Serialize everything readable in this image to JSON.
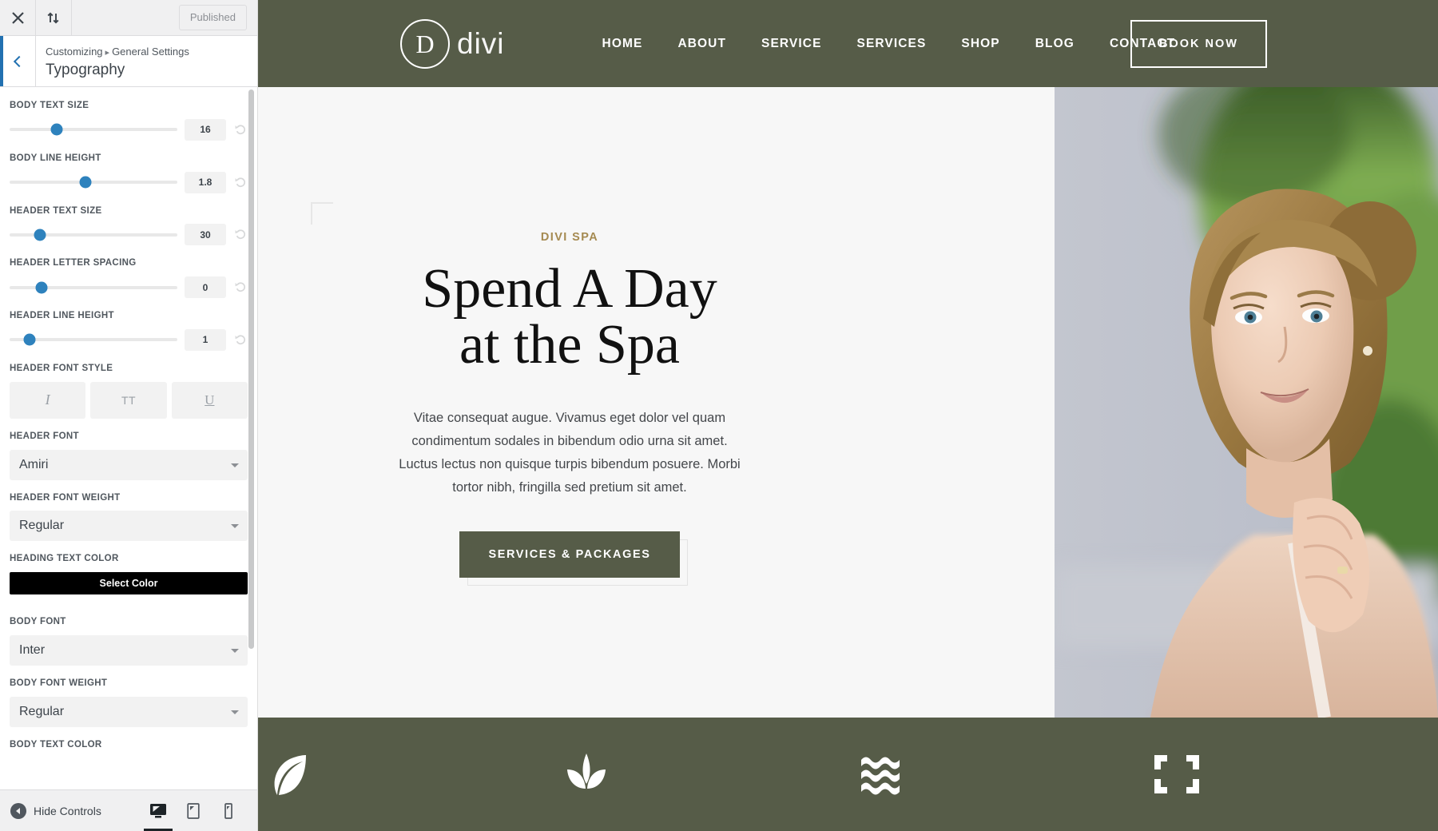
{
  "customizer": {
    "topbar": {
      "close_icon": "close-icon",
      "devices_icon": "collapse-arrows-icon",
      "published_label": "Published"
    },
    "header": {
      "back_icon": "chevron-left-icon",
      "breadcrumb_root": "Customizing",
      "breadcrumb_separator": "▸",
      "breadcrumb_parent": "General Settings",
      "title": "Typography"
    },
    "fields": [
      {
        "label": "BODY TEXT SIZE",
        "type": "range",
        "value": "16",
        "thumb_pct": 28
      },
      {
        "label": "BODY LINE HEIGHT",
        "type": "range",
        "value": "1.8",
        "thumb_pct": 45
      },
      {
        "label": "HEADER TEXT SIZE",
        "type": "range",
        "value": "30",
        "thumb_pct": 18
      },
      {
        "label": "HEADER LETTER SPACING",
        "type": "range",
        "value": "0",
        "thumb_pct": 19
      },
      {
        "label": "HEADER LINE HEIGHT",
        "type": "range",
        "value": "1",
        "thumb_pct": 12
      },
      {
        "label": "HEADER FONT STYLE",
        "type": "styles",
        "options": [
          "I",
          "TT",
          "U"
        ]
      },
      {
        "label": "HEADER FONT",
        "type": "select",
        "value": "Amiri"
      },
      {
        "label": "HEADER FONT WEIGHT",
        "type": "select",
        "value": "Regular"
      },
      {
        "label": "HEADING TEXT COLOR",
        "type": "color",
        "value": "Select Color",
        "swatch": "#000000"
      },
      {
        "label": "BODY FONT",
        "type": "select",
        "value": "Inter"
      },
      {
        "label": "BODY FONT WEIGHT",
        "type": "select",
        "value": "Regular"
      },
      {
        "label": "BODY TEXT COLOR",
        "type": "labelonly"
      }
    ],
    "footer": {
      "hide_controls_label": "Hide Controls",
      "devices": [
        {
          "name": "desktop-preview-button",
          "active": true
        },
        {
          "name": "tablet-preview-button",
          "active": false
        },
        {
          "name": "mobile-preview-button",
          "active": false
        }
      ]
    }
  },
  "preview": {
    "brand": {
      "mark_letter": "D",
      "word": "divi"
    },
    "nav_items": [
      "HOME",
      "ABOUT",
      "SERVICE",
      "SERVICES",
      "SHOP",
      "BLOG",
      "CONTACT"
    ],
    "book_now_label": "BOOK NOW",
    "hero": {
      "eyebrow": "DIVI SPA",
      "title_line1": "Spend A Day",
      "title_line2": "at the Spa",
      "paragraph": "Vitae consequat augue. Vivamus eget dolor vel quam condimentum sodales in bibendum odio urna sit amet. Luctus lectus non quisque turpis bibendum posuere. Morbi tortor nibh, fringilla sed pretium sit amet.",
      "cta_label": "SERVICES & PACKAGES"
    },
    "feature_icons": [
      "leaf-icon",
      "sprout-icon",
      "water-waves-icon",
      "resize-corners-icon"
    ],
    "colors": {
      "brand_green": "#565c48",
      "accent_gold": "#a58a51",
      "hero_bg": "#f7f7f7"
    }
  }
}
